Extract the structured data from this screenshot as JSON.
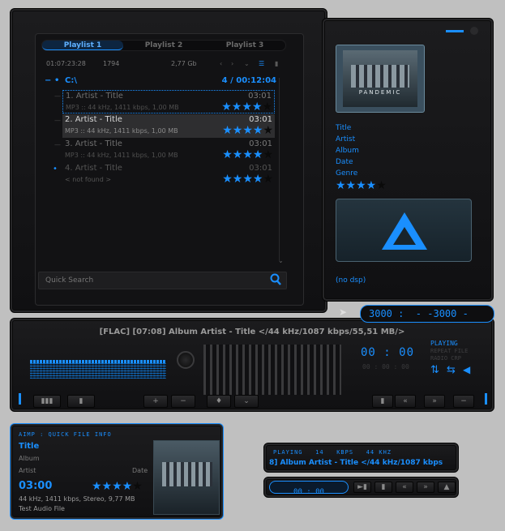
{
  "playlist": {
    "tabs": [
      "Playlist 1",
      "Playlist 2",
      "Playlist 3"
    ],
    "summary": {
      "duration": "01:07:23:28",
      "count": "1794",
      "size": "2,77 Gb"
    },
    "group": {
      "label": "C:\\",
      "info": "4 / 00:12:04"
    },
    "tracks": [
      {
        "title": "1. Artist - Title",
        "duration": "03:01",
        "info": "MP3 :: 44 kHz, 1411 kbps, 1,00 MB",
        "rating": 4
      },
      {
        "title": "2. Artist - Title",
        "duration": "03:01",
        "info": "MP3 :: 44 kHz, 1411 kbps, 1,00 MB",
        "rating": 4
      },
      {
        "title": "3. Artist - Title",
        "duration": "03:01",
        "info": "MP3 :: 44 kHz, 1411 kbps, 1,00 MB",
        "rating": 4
      },
      {
        "title": "4. Artist - Title",
        "duration": "03:01",
        "info": "< not found >",
        "rating": 4
      }
    ],
    "search_placeholder": "Quick Search"
  },
  "info_panel": {
    "fields": [
      "Title",
      "Artist",
      "Album",
      "Date",
      "Genre"
    ],
    "rating": 4,
    "dsp": "(no dsp)",
    "cover_text": "PANDEMIC"
  },
  "player": {
    "marquee": "[FLAC] [07:08] Album Artist - Title </44 kHz/1087 kbps/55,51 MB/>",
    "time": "00 : 00",
    "time_sub": "00 : 00 : 00",
    "status": "PLAYING",
    "status_lines": [
      "REPEAT FILE",
      "RADIO  CRP"
    ],
    "counter": "3000 :  - -3000 -"
  },
  "quick_info": {
    "header": "AIMP : QUICK FILE INFO",
    "title": "Title",
    "album": "Album",
    "artist": "Artist",
    "date": "Date",
    "time": "03:00",
    "rating": 4,
    "details": "44 kHz, 1411 kbps, Stereo, 9,77 MB",
    "file": "Test Audio File"
  },
  "mini": {
    "status_line": "PLAYING   14   KBPS   44 KHZ",
    "marquee": "8] Album Artist - Title </44 kHz/1087 kbps",
    "time": "00 : 00"
  }
}
